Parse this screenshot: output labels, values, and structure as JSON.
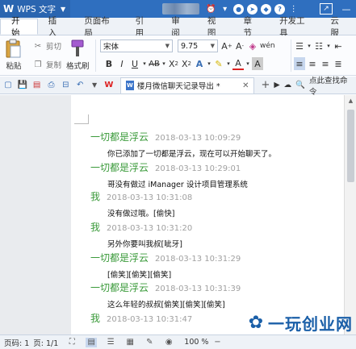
{
  "app": {
    "logo_letter": "W",
    "title": "WPS 文字"
  },
  "titlebar": {
    "question_icon_text": "?"
  },
  "tabs": [
    "开始",
    "插入",
    "页面布局",
    "引用",
    "审阅",
    "视图",
    "章节",
    "开发工具",
    "云服"
  ],
  "active_tab": "开始",
  "ribbon": {
    "paste_label": "粘贴",
    "cut_label": "剪切",
    "copy_label": "复制",
    "format_painter_label": "格式刷",
    "font_name": "宋体",
    "font_size": "9.75"
  },
  "quickaccess": {
    "doc_tab_title": "楼月微信聊天记录导出 *",
    "find_command": "点此查找命令"
  },
  "messages": [
    {
      "name": "一切都是浮云",
      "time": "2018-03-13 10:09:29",
      "text": "你已添加了一切都是浮云，现在可以开始聊天了。"
    },
    {
      "name": "一切都是浮云",
      "time": "2018-03-13 10:29:01",
      "text": "哥没有做过 iManager 设计项目管理系统"
    },
    {
      "name": "我",
      "time": "2018-03-13 10:31:08",
      "text": "没有做过哦。[偷快]"
    },
    {
      "name": "我",
      "time": "2018-03-13 10:31:20",
      "text": "另外你要叫我叔[呲牙]"
    },
    {
      "name": "一切都是浮云",
      "time": "2018-03-13 10:31:29",
      "text": "[偷笑][偷笑][偷笑]"
    },
    {
      "name": "一切都是浮云",
      "time": "2018-03-13 10:31:39",
      "text": "这么年轻的叔叔[偷笑][偷笑][偷笑]"
    },
    {
      "name": "我",
      "time": "2018-03-13 10:31:47",
      "text": ""
    }
  ],
  "statusbar": {
    "page_num": "页码: 1",
    "page_count": "页: 1/1",
    "zoom": "100 %"
  },
  "watermark": {
    "text": "一玩创业网"
  },
  "colors": {
    "titlebar": "#2f6fbf",
    "sender_name": "#3a9a3a",
    "timestamp": "#a0a0a0"
  }
}
